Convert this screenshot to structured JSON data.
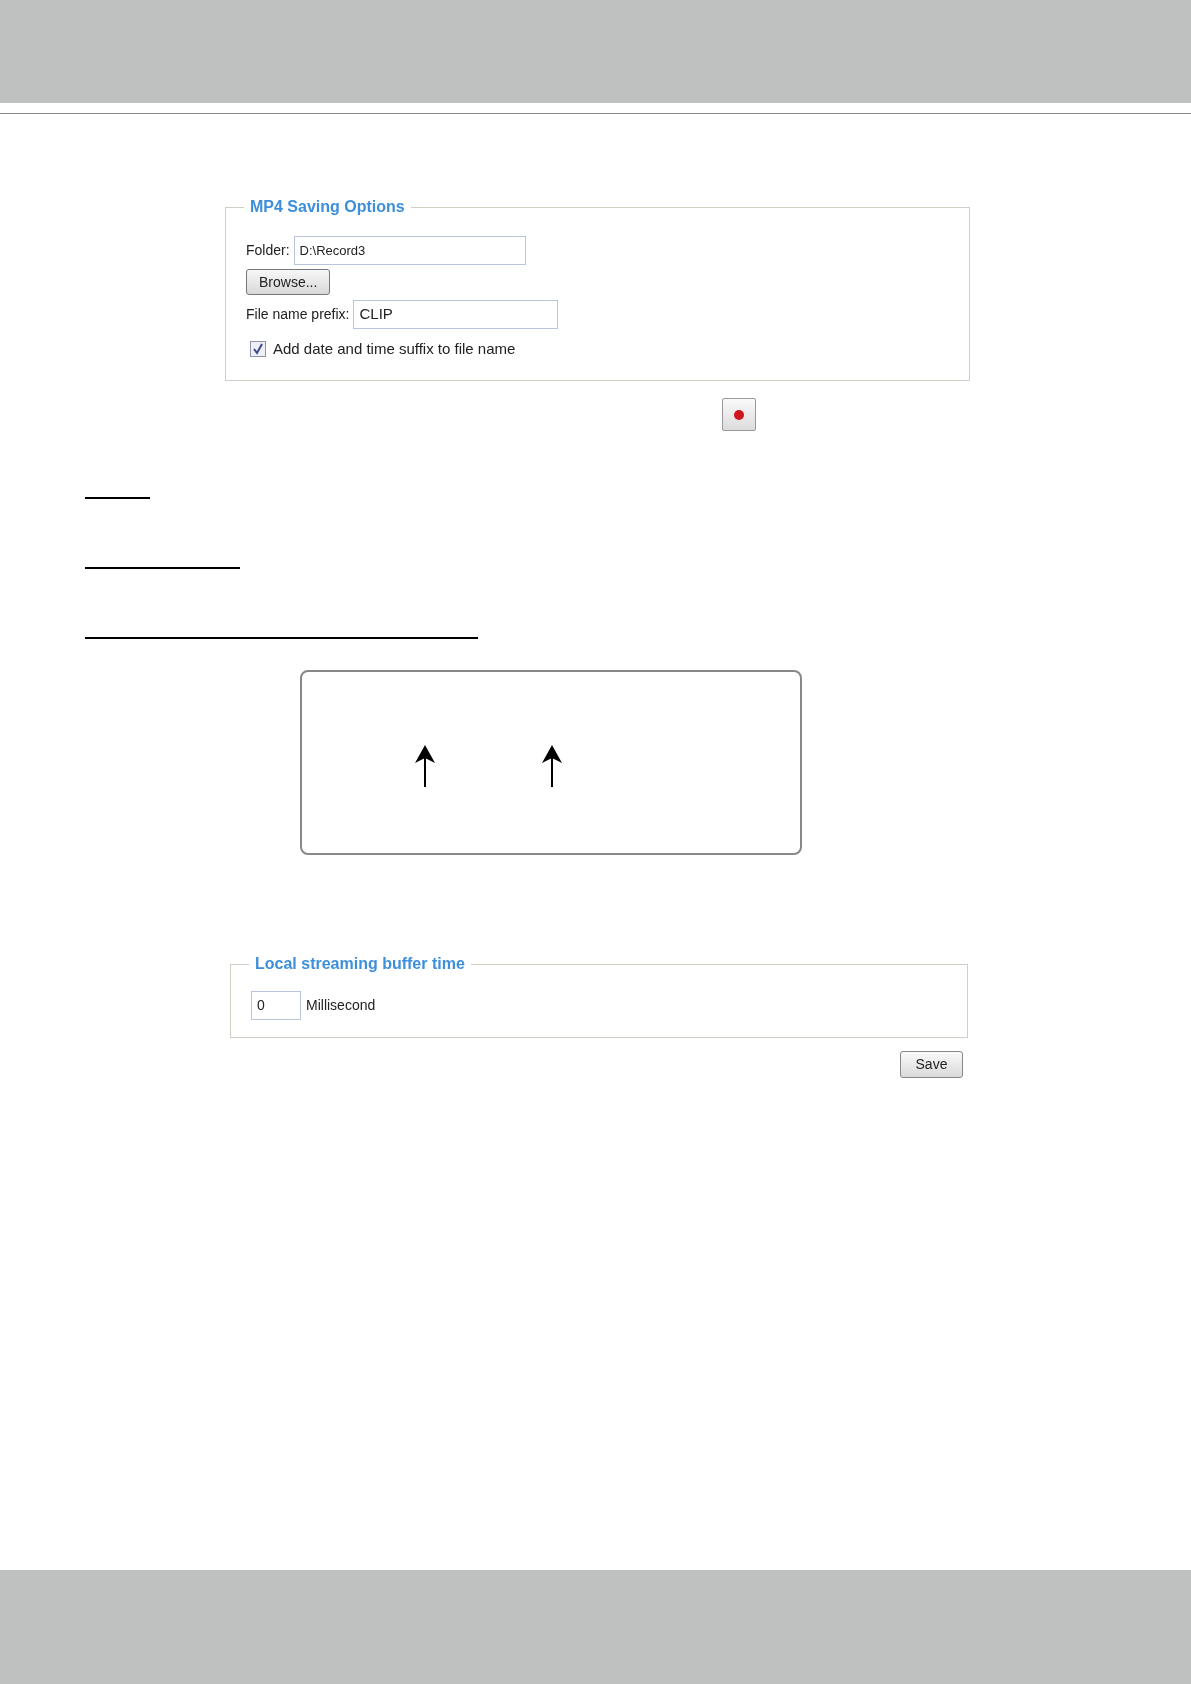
{
  "mp4_saving_options": {
    "legend": "MP4 Saving Options",
    "folder": {
      "label": "Folder:",
      "value": "D:\\Record3"
    },
    "browse_button": "Browse...",
    "file_name_prefix": {
      "label": "File name prefix:",
      "value": "CLIP"
    },
    "date_time_suffix": {
      "label": "Add date and time suffix to file name",
      "checked": true
    }
  },
  "local_streaming_buffer_time": {
    "legend": "Local streaming buffer time",
    "value": "0",
    "unit": "Millisecond"
  },
  "save_button": "Save"
}
